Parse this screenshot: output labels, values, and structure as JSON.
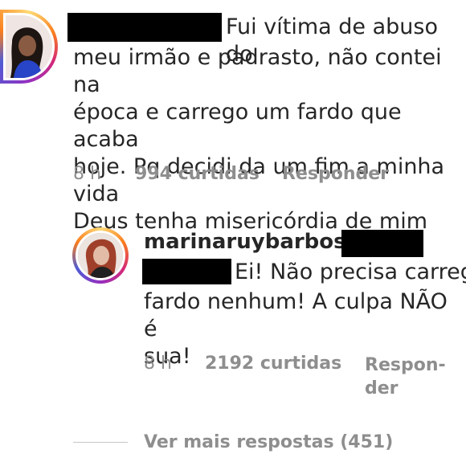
{
  "comment": {
    "text_line1": "Fui vítima de abuso do",
    "text_rest": "meu irmão e padrasto, não contei na\népoca e carrego um fardo que acaba\nhoje. Pq decidi da um fim a minha vida\nDeus tenha misericórdia de mim",
    "time": "8 h",
    "likes": "994 curtidas",
    "reply_label": "Responder",
    "avatar_icon": "profile-photo"
  },
  "reply": {
    "username": "marinaruybarbosa",
    "text_line1": "Ei! Não precisa carregar",
    "text_rest": "fardo nenhum! A culpa NÃO é\nsua!",
    "time": "8 h",
    "likes": "2192 curtidas",
    "reply_label": "Respon-\nder",
    "avatar_icon": "profile-photo"
  },
  "more_replies": "Ver mais respostas (451)",
  "colors": {
    "text": "#262626",
    "muted": "#8e8e8e",
    "redaction": "#000000"
  }
}
